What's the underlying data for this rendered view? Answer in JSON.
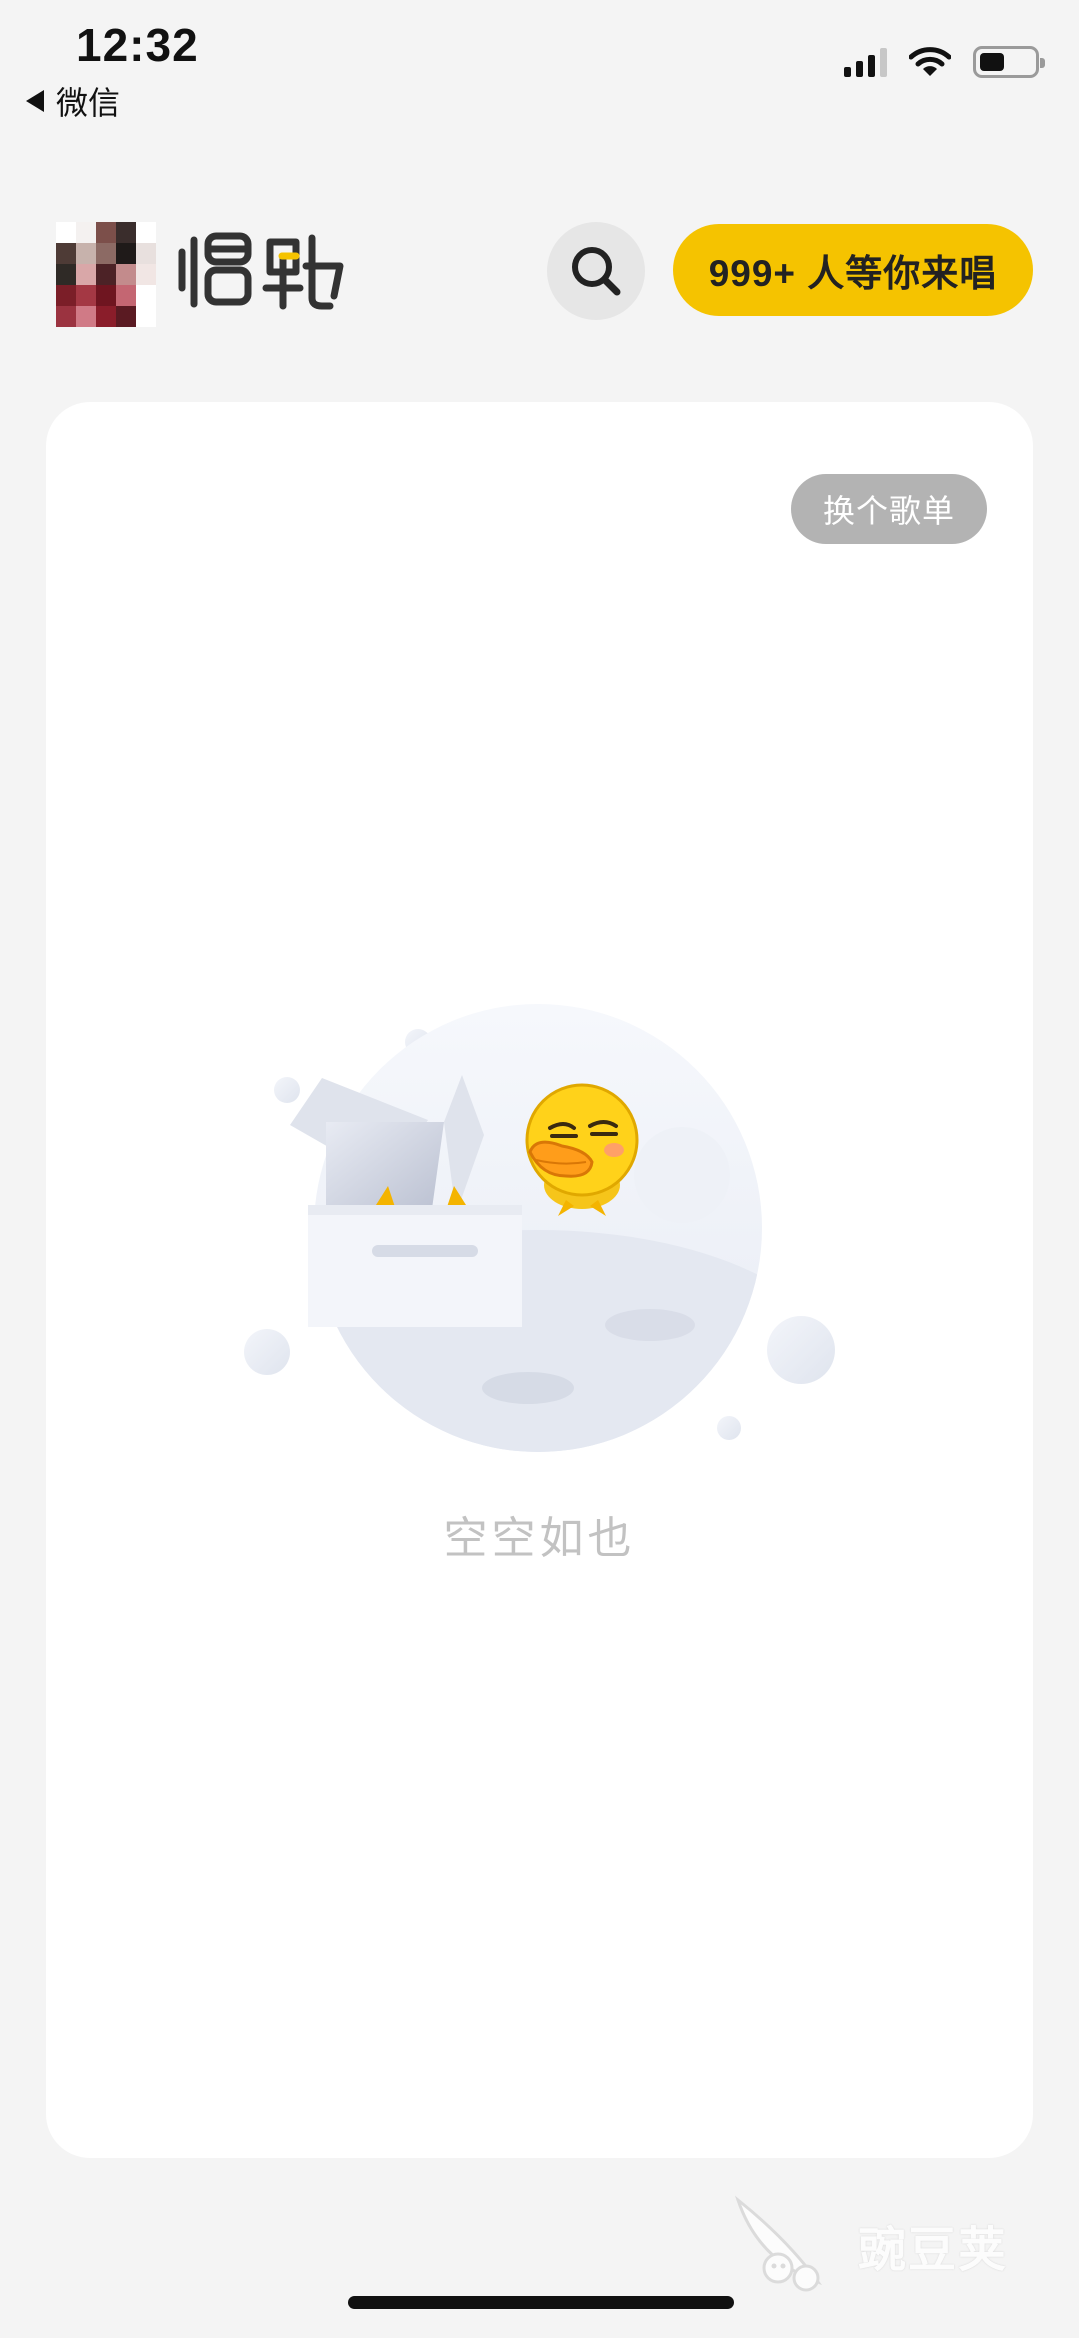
{
  "status_bar": {
    "time": "12:32",
    "back_label": "微信"
  },
  "header": {
    "logo_text": "唱鸭",
    "cta_label": "999+ 人等你来唱",
    "search_icon": "search-icon",
    "avatar": "pixelated-avatar"
  },
  "card": {
    "switch_playlist_label": "换个歌单",
    "empty_state_text": "空空如也",
    "illustration": "duck-in-box-empty-illustration"
  },
  "watermark": {
    "text": "豌豆荚"
  },
  "colors": {
    "accent_yellow": "#f5c300",
    "page_bg": "#f4f4f4",
    "card_bg": "#ffffff",
    "muted_text": "#c2c2c2",
    "pill_gray": "#b3b3b3"
  }
}
